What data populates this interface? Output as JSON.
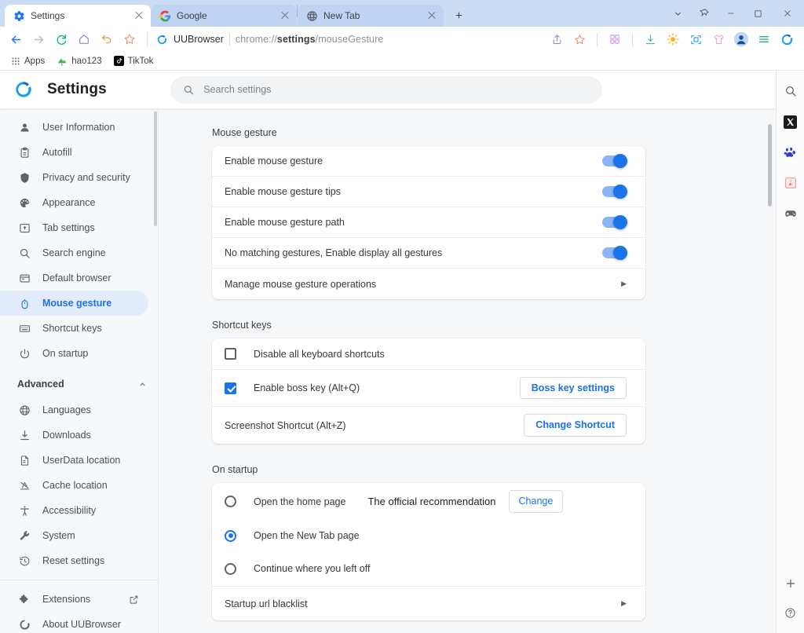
{
  "window": {
    "tabs": [
      {
        "title": "Settings",
        "icon": "gear-icon",
        "active": true
      },
      {
        "title": "Google",
        "icon": "google-icon",
        "active": false
      },
      {
        "title": "New Tab",
        "icon": "globe-icon",
        "active": false
      }
    ],
    "new_tab_label": "+",
    "controls": [
      "chevron-down-icon",
      "pin-icon",
      "minimize-icon",
      "maximize-icon",
      "close-icon"
    ]
  },
  "toolbar": {
    "back": "back-icon",
    "forward": "forward-icon",
    "reload": "reload-icon",
    "home": "home-icon",
    "history": "undo-icon",
    "favorite": "star-icon",
    "brand": "UUBrowser",
    "url_prefix": "chrome://",
    "url_bold": "settings",
    "url_suffix": "/mouseGesture",
    "right_icons": [
      "share-icon",
      "star-outline-icon",
      "apps-grid-icon",
      "download-icon",
      "brightness-icon",
      "screenshot-icon",
      "shirt-icon",
      "profile-icon",
      "menu-icon",
      "uubrowser-logo-icon"
    ]
  },
  "bookmarks": [
    {
      "label": "Apps",
      "icon": "apps-grid-icon"
    },
    {
      "label": "hao123",
      "icon": "hao123-icon"
    },
    {
      "label": "TikTok",
      "icon": "tiktok-icon"
    }
  ],
  "header": {
    "logo": "uubrowser-logo-icon",
    "title": "Settings",
    "search_placeholder": "Search settings",
    "search_value": "",
    "search_icon": "search-icon"
  },
  "sidebar": {
    "items": [
      {
        "label": "User Information",
        "icon": "person-icon",
        "selected": false
      },
      {
        "label": "Autofill",
        "icon": "clipboard-icon",
        "selected": false
      },
      {
        "label": "Privacy and security",
        "icon": "shield-icon",
        "selected": false
      },
      {
        "label": "Appearance",
        "icon": "palette-icon",
        "selected": false
      },
      {
        "label": "Tab settings",
        "icon": "tab-icon",
        "selected": false
      },
      {
        "label": "Search engine",
        "icon": "search-icon",
        "selected": false
      },
      {
        "label": "Default browser",
        "icon": "browser-window-icon",
        "selected": false
      },
      {
        "label": "Mouse gesture",
        "icon": "mouse-icon",
        "selected": true
      },
      {
        "label": "Shortcut keys",
        "icon": "keyboard-icon",
        "selected": false
      },
      {
        "label": "On startup",
        "icon": "power-icon",
        "selected": false
      }
    ],
    "advanced": {
      "label": "Advanced",
      "expanded": true,
      "icon": "chevron-up-icon"
    },
    "advanced_items": [
      {
        "label": "Languages",
        "icon": "globe-icon"
      },
      {
        "label": "Downloads",
        "icon": "download-icon"
      },
      {
        "label": "UserData location",
        "icon": "document-icon"
      },
      {
        "label": "Cache location",
        "icon": "cache-icon"
      },
      {
        "label": "Accessibility",
        "icon": "accessibility-icon"
      },
      {
        "label": "System",
        "icon": "wrench-icon"
      },
      {
        "label": "Reset settings",
        "icon": "restore-icon"
      }
    ],
    "footer_items": [
      {
        "label": "Extensions",
        "icon": "puzzle-icon",
        "external": true
      },
      {
        "label": "About UUBrowser",
        "icon": "uubrowser-logo-icon",
        "external": false
      }
    ]
  },
  "main": {
    "mouse_gesture": {
      "title": "Mouse gesture",
      "rows": [
        {
          "label": "Enable mouse gesture",
          "control": "toggle",
          "on": true
        },
        {
          "label": "Enable mouse gesture tips",
          "control": "toggle",
          "on": true
        },
        {
          "label": "Enable mouse gesture path",
          "control": "toggle",
          "on": true
        },
        {
          "label": "No matching gestures, Enable display all gestures",
          "control": "toggle",
          "on": true
        },
        {
          "label": "Manage mouse gesture operations",
          "control": "chevron",
          "on": false
        }
      ]
    },
    "shortcut_keys": {
      "title": "Shortcut keys",
      "rows": [
        {
          "label": "Disable all keyboard shortcuts",
          "control": "checkbox",
          "checked": false,
          "button": ""
        },
        {
          "label": "Enable boss key (Alt+Q)",
          "control": "checkbox",
          "checked": true,
          "button": "Boss key settings"
        },
        {
          "label": "Screenshot Shortcut  (Alt+Z)",
          "control": "none",
          "checked": false,
          "button": "Change Shortcut"
        }
      ]
    },
    "on_startup": {
      "title": "On startup",
      "rows": [
        {
          "label": "Open the home page",
          "control": "radio",
          "selected": false,
          "hint": "The official recommendation",
          "button": "Change"
        },
        {
          "label": "Open the New Tab page",
          "control": "radio",
          "selected": true,
          "hint": "",
          "button": ""
        },
        {
          "label": "Continue where you left off",
          "control": "radio",
          "selected": false,
          "hint": "",
          "button": ""
        },
        {
          "label": "Startup url blacklist",
          "control": "chevron",
          "selected": false,
          "hint": "",
          "button": ""
        }
      ]
    }
  },
  "rail": {
    "top_icons": [
      "search-icon",
      "x-twitter-icon",
      "baidu-icon",
      "pdf-icon",
      "gamepad-icon"
    ],
    "bottom_icons": [
      "plus-icon",
      "help-icon"
    ]
  },
  "colors": {
    "accent": "#1a73e8",
    "toggle_track": "#8ab4f8",
    "titlebar": "#cbdcf5",
    "content_bg": "#f6f7f9",
    "sidebar_bg": "#f7f8fa",
    "selected_bg": "#e3ecfd"
  }
}
